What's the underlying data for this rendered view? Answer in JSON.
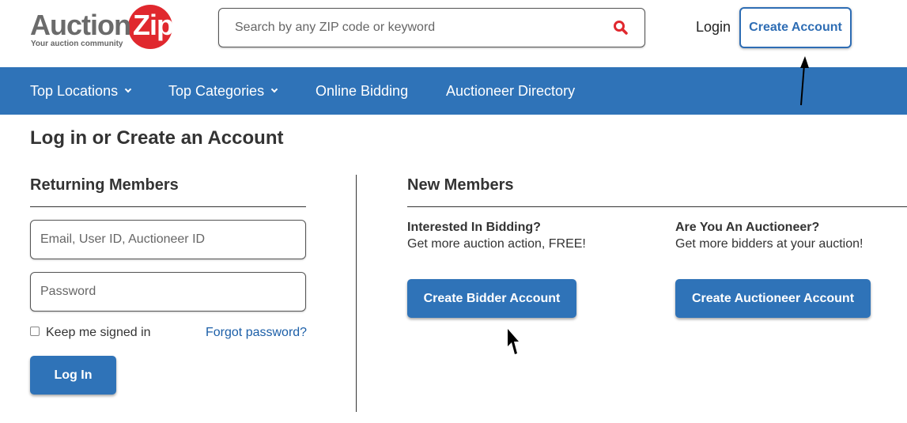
{
  "header": {
    "logo": {
      "name": "AuctionZip",
      "part1": "Auction",
      "part2": "Zip",
      "tagline": "Your auction community"
    },
    "search": {
      "placeholder": "Search by any ZIP code or keyword",
      "icon": "search-icon"
    },
    "login_label": "Login",
    "create_account_label": "Create Account"
  },
  "nav": {
    "items": [
      {
        "label": "Top Locations",
        "has_dropdown": true
      },
      {
        "label": "Top Categories",
        "has_dropdown": true
      },
      {
        "label": "Online Bidding",
        "has_dropdown": false
      },
      {
        "label": "Auctioneer Directory",
        "has_dropdown": false
      }
    ]
  },
  "main": {
    "title": "Log in or Create an Account",
    "returning": {
      "heading": "Returning Members",
      "email_placeholder": "Email, User ID, Auctioneer ID",
      "password_placeholder": "Password",
      "keep_signed_in": "Keep me signed in",
      "forgot_password": "Forgot password?",
      "login_button": "Log In"
    },
    "new_members": {
      "heading": "New Members",
      "bidder": {
        "heading": "Interested In Bidding?",
        "text": "Get more auction action, FREE!",
        "button": "Create Bidder Account"
      },
      "auctioneer": {
        "heading": "Are You An Auctioneer?",
        "text": "Get more bidders at your auction!",
        "button": "Create Auctioneer Account"
      }
    }
  },
  "colors": {
    "brand_blue": "#2f73b8",
    "link_blue": "#1c5fa8",
    "logo_red": "#e0282e"
  }
}
